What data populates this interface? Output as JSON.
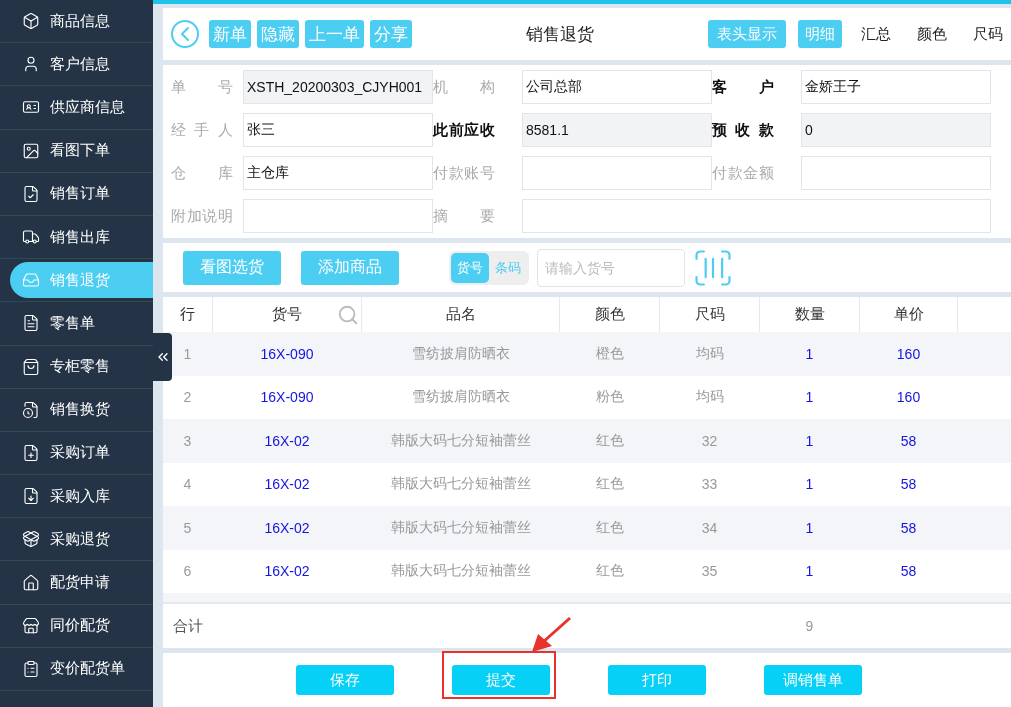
{
  "sidebar": {
    "items": [
      {
        "label": "商品信息",
        "selected": false
      },
      {
        "label": "客户信息",
        "selected": false
      },
      {
        "label": "供应商信息",
        "selected": false
      },
      {
        "label": "看图下单",
        "selected": false
      },
      {
        "label": "销售订单",
        "selected": false
      },
      {
        "label": "销售出库",
        "selected": false
      },
      {
        "label": "销售退货",
        "selected": true
      },
      {
        "label": "零售单",
        "selected": false
      },
      {
        "label": "专柜零售",
        "selected": false
      },
      {
        "label": "销售换货",
        "selected": false
      },
      {
        "label": "采购订单",
        "selected": false
      },
      {
        "label": "采购入库",
        "selected": false
      },
      {
        "label": "采购退货",
        "selected": false
      },
      {
        "label": "配货申请",
        "selected": false
      },
      {
        "label": "同价配货",
        "selected": false
      },
      {
        "label": "变价配货单",
        "selected": false
      }
    ]
  },
  "header": {
    "title": "销售退货",
    "actions": [
      "新单",
      "隐藏",
      "上一单",
      "分享"
    ],
    "header_toggle": "表头显示",
    "views": [
      {
        "label": "明细",
        "selected": true
      },
      {
        "label": "汇总",
        "selected": false
      },
      {
        "label": "颜色",
        "selected": false
      },
      {
        "label": "尺码",
        "selected": false
      }
    ]
  },
  "form": {
    "fields": [
      {
        "label": "单 号",
        "value": "XSTH_20200303_CJYH001",
        "emphasis": false,
        "readonly": true
      },
      {
        "label": "机 构",
        "value": "公司总部",
        "emphasis": false,
        "readonly": false
      },
      {
        "label": "客 户",
        "value": "金娇王子",
        "emphasis": true,
        "readonly": false
      },
      {
        "label": "经 手 人",
        "value": "张三",
        "emphasis": false,
        "readonly": false
      },
      {
        "label": "此前应收",
        "value": "8581.1",
        "emphasis": true,
        "readonly": true
      },
      {
        "label": "预 收 款",
        "value": "0",
        "emphasis": true,
        "readonly": true
      },
      {
        "label": "仓 库",
        "value": "主仓库",
        "emphasis": false,
        "readonly": false
      },
      {
        "label": "付款账号",
        "emphasis": false,
        "readonly": false
      },
      {
        "label": "付款金额",
        "emphasis": false,
        "readonly": false
      },
      {
        "label": "附加说明",
        "emphasis": false,
        "readonly": false
      },
      {
        "label": "摘 要",
        "emphasis": false,
        "readonly": false,
        "wide": true
      }
    ]
  },
  "toolbar": {
    "buttons": [
      "看图选货",
      "添加商品"
    ],
    "mode": [
      {
        "label": "货号",
        "selected": true
      },
      {
        "label": "条码",
        "selected": false
      }
    ],
    "search": {
      "placeholder": "请输入货号"
    }
  },
  "table": {
    "columns": [
      "行",
      "货号",
      "品名",
      "颜色",
      "尺码",
      "数量",
      "单价"
    ],
    "rows": [
      [
        "1",
        "16X-090",
        "雪纺披肩防晒衣",
        "橙色",
        "均码",
        "1",
        "160"
      ],
      [
        "2",
        "16X-090",
        "雪纺披肩防晒衣",
        "粉色",
        "均码",
        "1",
        "160"
      ],
      [
        "3",
        "16X-02",
        "韩版大码七分短袖蕾丝",
        "红色",
        "32",
        "1",
        "58"
      ],
      [
        "4",
        "16X-02",
        "韩版大码七分短袖蕾丝",
        "红色",
        "33",
        "1",
        "58"
      ],
      [
        "5",
        "16X-02",
        "韩版大码七分短袖蕾丝",
        "红色",
        "34",
        "1",
        "58"
      ],
      [
        "6",
        "16X-02",
        "韩版大码七分短袖蕾丝",
        "红色",
        "35",
        "1",
        "58"
      ]
    ],
    "total": {
      "label": "合计",
      "quantity": "9"
    }
  },
  "footer": {
    "buttons": [
      {
        "label": "保存",
        "highlighted": false
      },
      {
        "label": "提交",
        "highlighted": true
      },
      {
        "label": "打印",
        "highlighted": false
      },
      {
        "label": "调销售单",
        "highlighted": false
      }
    ]
  }
}
